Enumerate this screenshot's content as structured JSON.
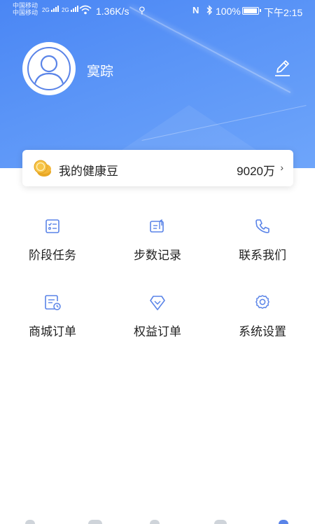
{
  "status_bar": {
    "carrier_line1": "中国移动",
    "carrier_line2": "中国移动",
    "net1": "2G",
    "net2": "2G",
    "speed": "1.36K/s",
    "battery": "100%",
    "battery_level": 1.0,
    "time": "下午2:15"
  },
  "profile": {
    "username": "寞踪"
  },
  "points_card": {
    "label": "我的健康豆",
    "value": "9020万",
    "arrow": "›"
  },
  "menu": [
    {
      "label": "阶段任务",
      "icon": "task-list-icon"
    },
    {
      "label": "步数记录",
      "icon": "step-record-icon"
    },
    {
      "label": "联系我们",
      "icon": "phone-icon"
    },
    {
      "label": "商城订单",
      "icon": "mall-order-icon"
    },
    {
      "label": "权益订单",
      "icon": "benefit-order-icon"
    },
    {
      "label": "系统设置",
      "icon": "settings-gear-icon"
    }
  ],
  "colors": {
    "header_blue": "#4a86f4",
    "icon_blue": "#5a84e8",
    "coin_gold": "#f3b73a"
  }
}
